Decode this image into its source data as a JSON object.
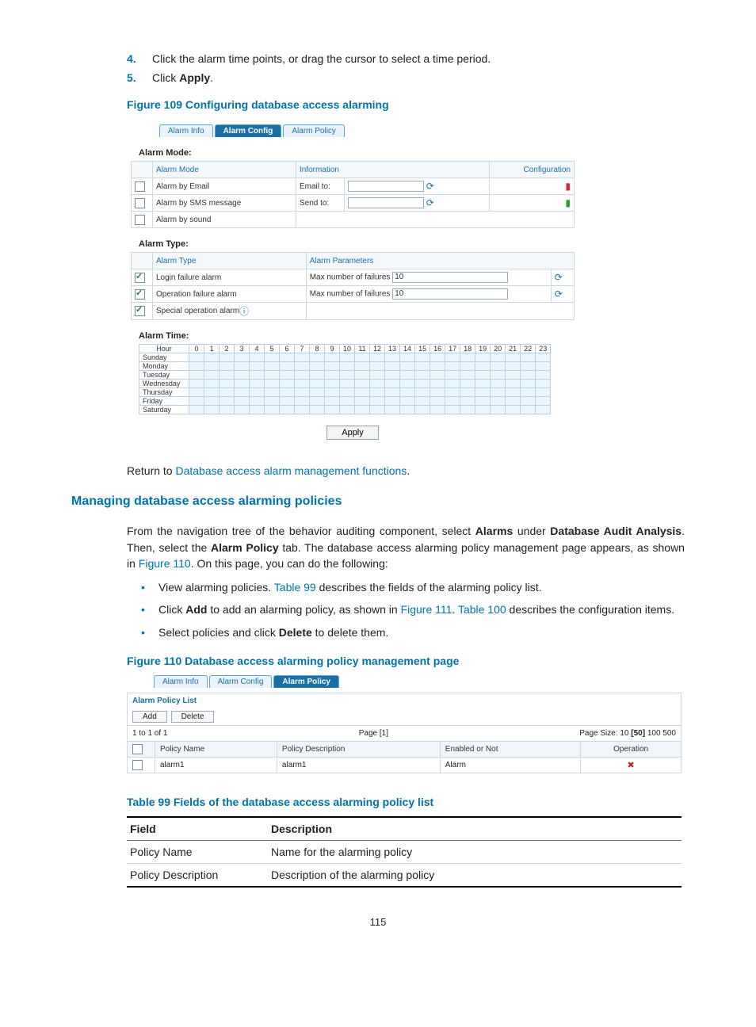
{
  "steps": [
    {
      "num": "4.",
      "text_before": "Click the alarm time points, or drag the cursor to select a time period.",
      "bold": ""
    },
    {
      "num": "5.",
      "text_before": "Click ",
      "bold": "Apply",
      "text_after": "."
    }
  ],
  "fig109_caption": "Figure 109 Configuring database access alarming",
  "fig109": {
    "tabs": [
      "Alarm Info",
      "Alarm Config",
      "Alarm Policy"
    ],
    "active_tab": 1,
    "alarm_mode_title": "Alarm Mode:",
    "mode_headers": [
      "Alarm Mode",
      "Information",
      "",
      "Configuration"
    ],
    "modes": [
      {
        "name": "Alarm by Email",
        "label": "Email to:",
        "value": "",
        "cfg": "red"
      },
      {
        "name": "Alarm by SMS message",
        "label": "Send to:",
        "value": "",
        "cfg": "green"
      },
      {
        "name": "Alarm by sound",
        "label": "",
        "value": "",
        "cfg": ""
      }
    ],
    "alarm_type_title": "Alarm Type:",
    "type_headers": [
      "Alarm Type",
      "Alarm Parameters",
      ""
    ],
    "types": [
      {
        "checked": true,
        "name": "Login failure alarm",
        "param_label": "Max number of failures",
        "param_value": "10"
      },
      {
        "checked": true,
        "name": "Operation failure alarm",
        "param_label": "Max number of failures",
        "param_value": "10"
      },
      {
        "checked": true,
        "name": "Special operation alarm",
        "param_label": "",
        "param_value": ""
      }
    ],
    "alarm_time_title": "Alarm Time:",
    "hours": [
      "Hour",
      "0",
      "1",
      "2",
      "3",
      "4",
      "5",
      "6",
      "7",
      "8",
      "9",
      "10",
      "11",
      "12",
      "13",
      "14",
      "15",
      "16",
      "17",
      "18",
      "19",
      "20",
      "21",
      "22",
      "23"
    ],
    "days": [
      "Sunday",
      "Monday",
      "Tuesday",
      "Wednesday",
      "Thursday",
      "Friday",
      "Saturday"
    ],
    "apply": "Apply"
  },
  "return_text_prefix": "Return to ",
  "return_link": "Database access alarm management functions",
  "return_suffix": ".",
  "h2": "Managing database access alarming policies",
  "para1_parts": [
    "From the navigation tree of the behavior auditing component, select ",
    {
      "b": "Alarms"
    },
    " under ",
    {
      "b": "Database Audit Analysis"
    },
    ". Then, select the ",
    {
      "b": "Alarm Policy"
    },
    " tab. The database access alarming policy management page appears, as shown in ",
    {
      "l": "Figure 110"
    },
    ". On this page, you can do the following:"
  ],
  "bullets": [
    [
      "View alarming policies. ",
      {
        "l": "Table 99"
      },
      " describes the fields of the alarming policy list."
    ],
    [
      "Click ",
      {
        "b": "Add"
      },
      " to add an alarming policy, as shown in ",
      {
        "l": "Figure 111"
      },
      ". ",
      {
        "l": "Table 100"
      },
      " describes the configuration items."
    ],
    [
      "Select policies and click ",
      {
        "b": "Delete"
      },
      " to delete them."
    ]
  ],
  "fig110_caption": "Figure 110 Database access alarming policy management page",
  "fig110": {
    "tabs": [
      "Alarm Info",
      "Alarm Config",
      "Alarm Policy"
    ],
    "active_tab": 2,
    "list_title": "Alarm Policy List",
    "buttons": [
      "Add",
      "Delete"
    ],
    "pager_left": "1 to 1 of 1",
    "pager_mid": "Page [1]",
    "pager_right_label": "Page Size: 10 ",
    "pager_right_bold": "[50]",
    "pager_right_tail": " 100 500",
    "cols": [
      "",
      "Policy Name",
      "Policy Description",
      "Enabled or Not",
      "Operation"
    ],
    "row": {
      "name": "alarm1",
      "desc": "alarm1",
      "enabled": "Alarm"
    }
  },
  "tbl99_caption": "Table 99 Fields of the database access alarming policy list",
  "tbl99_headers": [
    "Field",
    "Description"
  ],
  "tbl99_rows": [
    [
      "Policy Name",
      "Name for the alarming policy"
    ],
    [
      "Policy Description",
      "Description of the alarming policy"
    ]
  ],
  "page_number": "115"
}
